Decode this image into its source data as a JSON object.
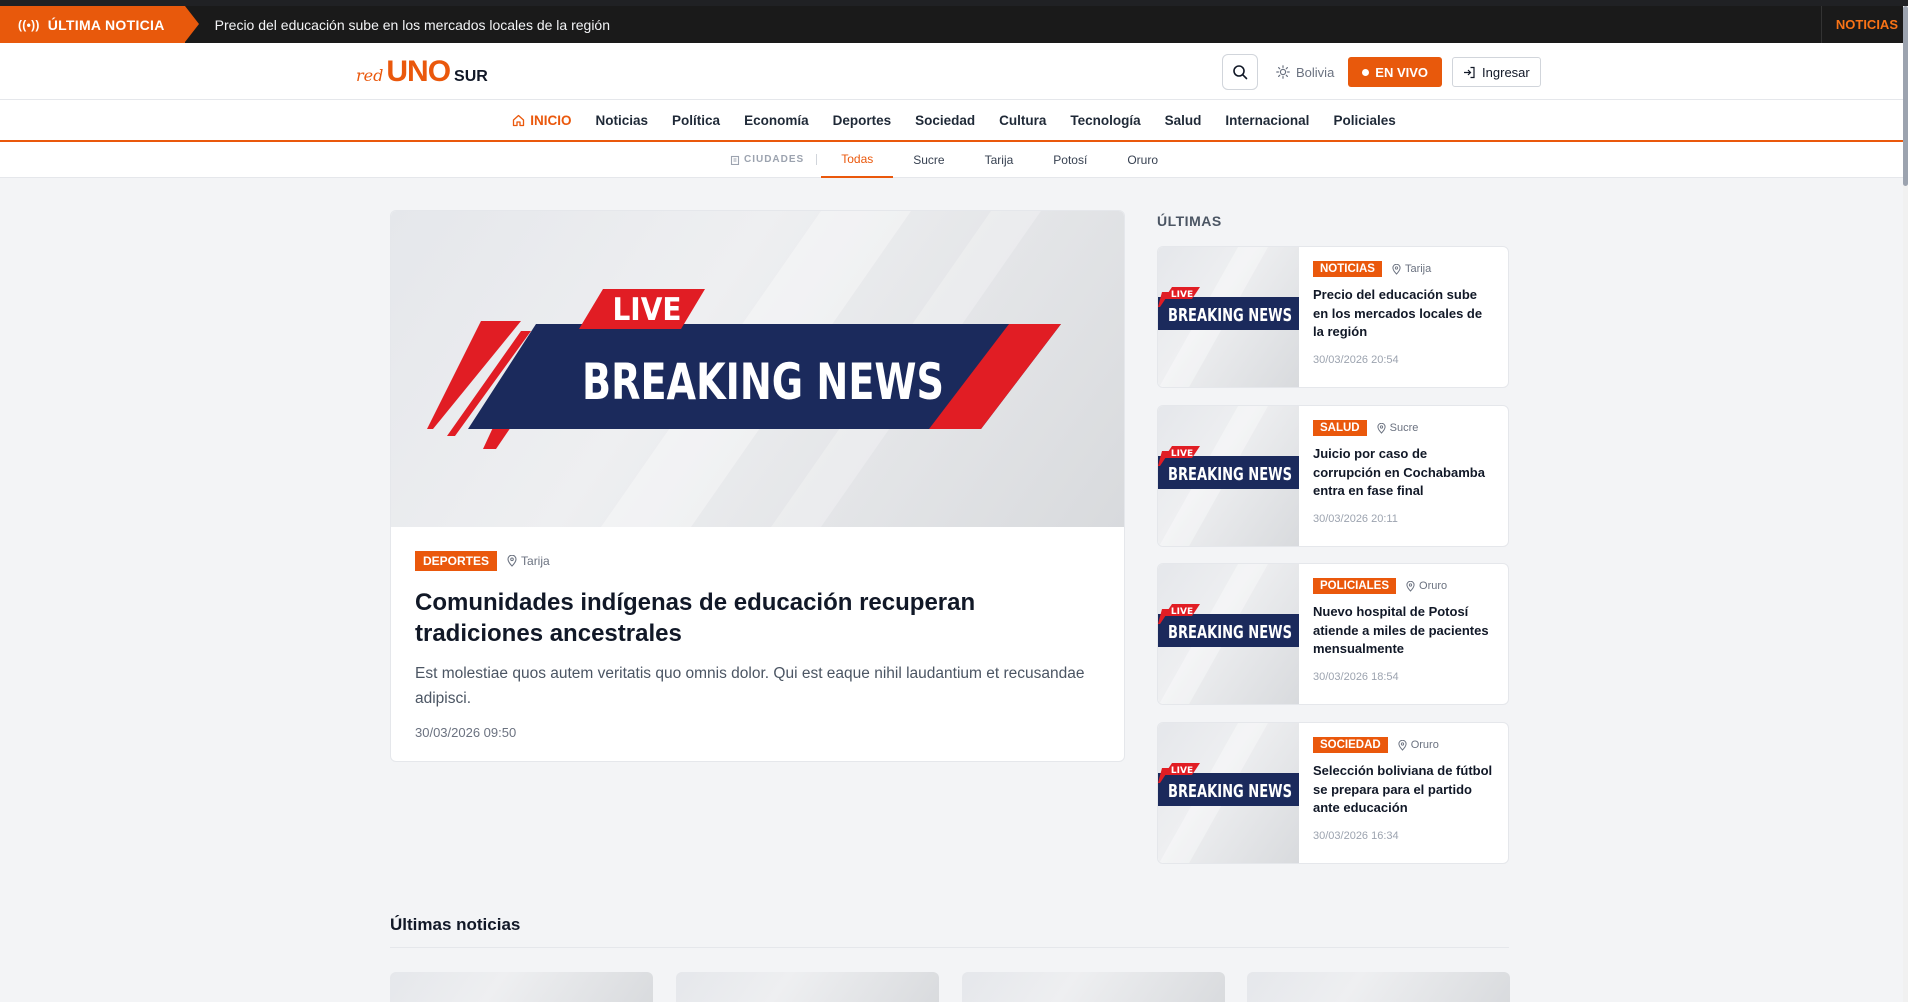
{
  "ticker": {
    "badge": "ÚLTIMA NOTICIA",
    "headline": "Precio del educación sube en los mercados locales de la región",
    "right_label": "NOTICIAS"
  },
  "header": {
    "logo_red": "red",
    "logo_uno": "UNO",
    "logo_sur": "SUR",
    "weather": "Bolivia",
    "live_label": "EN VIVO",
    "login_label": "Ingresar",
    "accent": "#ea580c"
  },
  "nav": {
    "items": [
      {
        "label": "INICIO",
        "icon": "home-icon",
        "active": true
      },
      {
        "label": "Noticias"
      },
      {
        "label": "Política"
      },
      {
        "label": "Economía"
      },
      {
        "label": "Deportes"
      },
      {
        "label": "Sociedad"
      },
      {
        "label": "Cultura"
      },
      {
        "label": "Tecnología"
      },
      {
        "label": "Salud"
      },
      {
        "label": "Internacional"
      },
      {
        "label": "Policiales"
      }
    ]
  },
  "cities": {
    "label": "CIUDADES",
    "items": [
      {
        "label": "Todas",
        "active": true
      },
      {
        "label": "Sucre"
      },
      {
        "label": "Tarija"
      },
      {
        "label": "Potosí"
      },
      {
        "label": "Oruro"
      }
    ]
  },
  "hero": {
    "image_live": "LIVE",
    "image_text": "BREAKING NEWS",
    "category": "DEPORTES",
    "location": "Tarija",
    "title": "Comunidades indígenas de educación recuperan tradiciones ancestrales",
    "excerpt": "Est molestiae quos autem veritatis quo omnis dolor. Qui est eaque nihil laudantium et recusandae adipisci.",
    "date": "30/03/2026 09:50"
  },
  "sidebar": {
    "title": "ÚLTIMAS",
    "items": [
      {
        "category": "NOTICIAS",
        "location": "Tarija",
        "headline": "Precio del educación sube en los mercados locales de la región",
        "date": "30/03/2026 20:54",
        "image_live": "LIVE",
        "image_text": "BREAKING NEWS"
      },
      {
        "category": "SALUD",
        "location": "Sucre",
        "headline": "Juicio por caso de corrupción en Cochabamba entra en fase final",
        "date": "30/03/2026 20:11",
        "image_live": "LIVE",
        "image_text": "BREAKING NEWS"
      },
      {
        "category": "POLICIALES",
        "location": "Oruro",
        "headline": "Nuevo hospital de Potosí atiende a miles de pacientes mensualmente",
        "date": "30/03/2026 18:54",
        "image_live": "LIVE",
        "image_text": "BREAKING NEWS"
      },
      {
        "category": "SOCIEDAD",
        "location": "Oruro",
        "headline": "Selección boliviana de fútbol se prepara para el partido ante educación",
        "date": "30/03/2026 16:34",
        "image_live": "LIVE",
        "image_text": "BREAKING NEWS"
      }
    ]
  },
  "latest": {
    "title": "Últimas noticias"
  }
}
